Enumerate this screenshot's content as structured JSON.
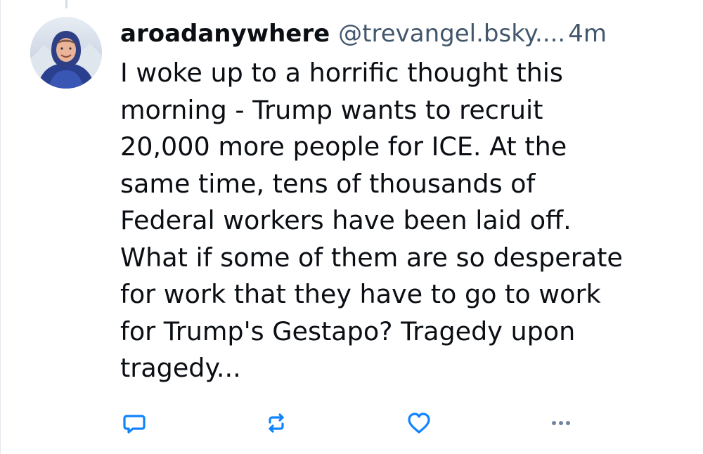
{
  "post": {
    "author": {
      "display_name": "aroadanywhere",
      "handle": "@trevangel.bsky....",
      "avatar_icon": "user-avatar-photo"
    },
    "timestamp": "4m",
    "text_lines": [
      "I woke up to a horrific thought this",
      "morning - Trump wants to recruit",
      "20,000 more people for ICE. At the",
      "same time, tens of thousands of",
      "Federal workers have been laid off.",
      "What if some of them are so desperate",
      "for work that they have to go to work",
      "for Trump's Gestapo? Tragedy upon",
      "tragedy..."
    ],
    "actions": [
      {
        "name": "reply",
        "icon": "comment-icon"
      },
      {
        "name": "repost",
        "icon": "repost-icon"
      },
      {
        "name": "like",
        "icon": "heart-icon"
      },
      {
        "name": "more",
        "icon": "more-dots-icon"
      }
    ]
  },
  "colors": {
    "text": "#0b0f14",
    "muted": "#42576c",
    "icon": "#1083fe",
    "icon_muted": "#6f869f"
  }
}
